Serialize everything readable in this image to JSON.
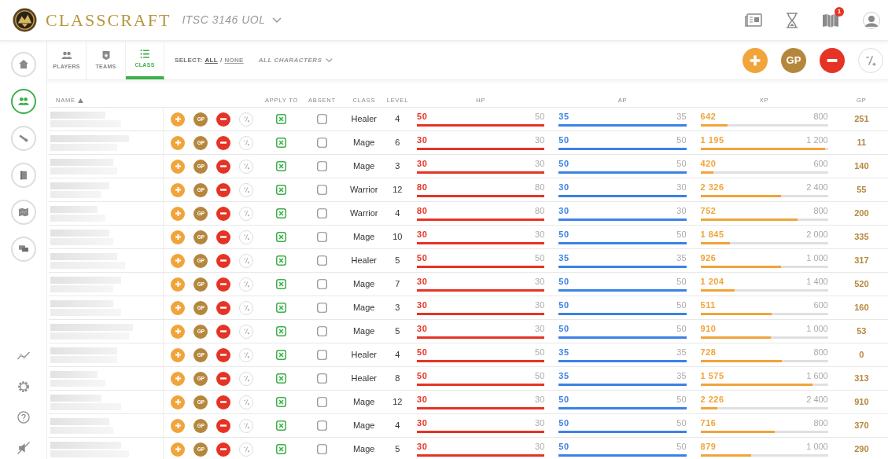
{
  "header": {
    "brand": "CLASSCRAFT",
    "course": "ITSC 3146 UOL",
    "notification_count": "1"
  },
  "sidebar": {
    "items": [
      {
        "kind": "home",
        "selected": false
      },
      {
        "kind": "players",
        "selected": true
      },
      {
        "kind": "tools",
        "selected": false
      },
      {
        "kind": "book",
        "selected": false
      },
      {
        "kind": "map",
        "selected": false
      },
      {
        "kind": "chat",
        "selected": false
      }
    ],
    "bottom": [
      {
        "kind": "stats"
      },
      {
        "kind": "settings"
      },
      {
        "kind": "help"
      },
      {
        "kind": "mute"
      }
    ]
  },
  "tabs": [
    {
      "label": "PLAYERS",
      "kind": "players",
      "selected": false
    },
    {
      "label": "TEAMS",
      "kind": "teams",
      "selected": false
    },
    {
      "label": "CLASS",
      "kind": "class",
      "selected": true
    }
  ],
  "select": {
    "label": "SELECT:",
    "all": "ALL",
    "separator": "/",
    "none": "NONE"
  },
  "filter": "ALL CHARACTERS",
  "actions": {
    "gp": "GP"
  },
  "table": {
    "columns": [
      "NAME",
      "APPLY TO",
      "ABSENT",
      "CLASS",
      "LEVEL",
      "HP",
      "AP",
      "XP",
      "GP"
    ],
    "rows": [
      {
        "gp_button": "GP",
        "class": "Healer",
        "level_text": "4",
        "hp": {
          "value": "50",
          "max": "50",
          "level": 1
        },
        "ap": {
          "value": "35",
          "max": "35",
          "level": 1
        },
        "xp": {
          "value": "642",
          "max": "800",
          "level": 0.21
        },
        "gp": "251",
        "apply": true,
        "absent": false
      },
      {
        "gp_button": "GP",
        "class": "Mage",
        "level_text": "6",
        "hp": {
          "value": "30",
          "max": "30",
          "level": 1
        },
        "ap": {
          "value": "50",
          "max": "50",
          "level": 1
        },
        "xp": {
          "value": "1 195",
          "max": "1 200",
          "level": 0.98
        },
        "gp": "11",
        "apply": true,
        "absent": false
      },
      {
        "gp_button": "GP",
        "class": "Mage",
        "level_text": "3",
        "hp": {
          "value": "30",
          "max": "30",
          "level": 1
        },
        "ap": {
          "value": "50",
          "max": "50",
          "level": 1
        },
        "xp": {
          "value": "420",
          "max": "600",
          "level": 0.1
        },
        "gp": "140",
        "apply": true,
        "absent": false
      },
      {
        "gp_button": "GP",
        "class": "Warrior",
        "level_text": "12",
        "hp": {
          "value": "80",
          "max": "80",
          "level": 1
        },
        "ap": {
          "value": "30",
          "max": "30",
          "level": 1
        },
        "xp": {
          "value": "2 326",
          "max": "2 400",
          "level": 0.63
        },
        "gp": "55",
        "apply": true,
        "absent": false
      },
      {
        "gp_button": "GP",
        "class": "Warrior",
        "level_text": "4",
        "hp": {
          "value": "80",
          "max": "80",
          "level": 1
        },
        "ap": {
          "value": "30",
          "max": "30",
          "level": 1
        },
        "xp": {
          "value": "752",
          "max": "800",
          "level": 0.76
        },
        "gp": "200",
        "apply": true,
        "absent": false
      },
      {
        "gp_button": "GP",
        "class": "Mage",
        "level_text": "10",
        "hp": {
          "value": "30",
          "max": "30",
          "level": 1
        },
        "ap": {
          "value": "50",
          "max": "50",
          "level": 1
        },
        "xp": {
          "value": "1 845",
          "max": "2 000",
          "level": 0.23
        },
        "gp": "335",
        "apply": true,
        "absent": false
      },
      {
        "gp_button": "GP",
        "class": "Healer",
        "level_text": "5",
        "hp": {
          "value": "50",
          "max": "50",
          "level": 1
        },
        "ap": {
          "value": "35",
          "max": "35",
          "level": 1
        },
        "xp": {
          "value": "926",
          "max": "1 000",
          "level": 0.63
        },
        "gp": "317",
        "apply": true,
        "absent": false
      },
      {
        "gp_button": "GP",
        "class": "Mage",
        "level_text": "7",
        "hp": {
          "value": "30",
          "max": "30",
          "level": 1
        },
        "ap": {
          "value": "50",
          "max": "50",
          "level": 1
        },
        "xp": {
          "value": "1 204",
          "max": "1 400",
          "level": 0.27
        },
        "gp": "520",
        "apply": true,
        "absent": false
      },
      {
        "gp_button": "GP",
        "class": "Mage",
        "level_text": "3",
        "hp": {
          "value": "30",
          "max": "30",
          "level": 1
        },
        "ap": {
          "value": "50",
          "max": "50",
          "level": 1
        },
        "xp": {
          "value": "511",
          "max": "600",
          "level": 0.56
        },
        "gp": "160",
        "apply": true,
        "absent": false
      },
      {
        "gp_button": "GP",
        "class": "Mage",
        "level_text": "5",
        "hp": {
          "value": "30",
          "max": "30",
          "level": 1
        },
        "ap": {
          "value": "50",
          "max": "50",
          "level": 1
        },
        "xp": {
          "value": "910",
          "max": "1 000",
          "level": 0.55
        },
        "gp": "53",
        "apply": true,
        "absent": false
      },
      {
        "gp_button": "GP",
        "class": "Healer",
        "level_text": "4",
        "hp": {
          "value": "50",
          "max": "50",
          "level": 1
        },
        "ap": {
          "value": "35",
          "max": "35",
          "level": 1
        },
        "xp": {
          "value": "728",
          "max": "800",
          "level": 0.64
        },
        "gp": "0",
        "apply": true,
        "absent": false
      },
      {
        "gp_button": "GP",
        "class": "Healer",
        "level_text": "8",
        "hp": {
          "value": "50",
          "max": "50",
          "level": 1
        },
        "ap": {
          "value": "35",
          "max": "35",
          "level": 1
        },
        "xp": {
          "value": "1 575",
          "max": "1 600",
          "level": 0.88
        },
        "gp": "313",
        "apply": true,
        "absent": false
      },
      {
        "gp_button": "GP",
        "class": "Mage",
        "level_text": "12",
        "hp": {
          "value": "30",
          "max": "30",
          "level": 1
        },
        "ap": {
          "value": "50",
          "max": "50",
          "level": 1
        },
        "xp": {
          "value": "2 226",
          "max": "2 400",
          "level": 0.13
        },
        "gp": "910",
        "apply": true,
        "absent": false
      },
      {
        "gp_button": "GP",
        "class": "Mage",
        "level_text": "4",
        "hp": {
          "value": "30",
          "max": "30",
          "level": 1
        },
        "ap": {
          "value": "50",
          "max": "50",
          "level": 1
        },
        "xp": {
          "value": "716",
          "max": "800",
          "level": 0.58
        },
        "gp": "370",
        "apply": true,
        "absent": false
      },
      {
        "gp_button": "GP",
        "class": "Mage",
        "level_text": "5",
        "hp": {
          "value": "30",
          "max": "30",
          "level": 1
        },
        "ap": {
          "value": "50",
          "max": "50",
          "level": 1
        },
        "xp": {
          "value": "879",
          "max": "1 000",
          "level": 0.4
        },
        "gp": "290",
        "apply": true,
        "absent": false
      }
    ]
  }
}
